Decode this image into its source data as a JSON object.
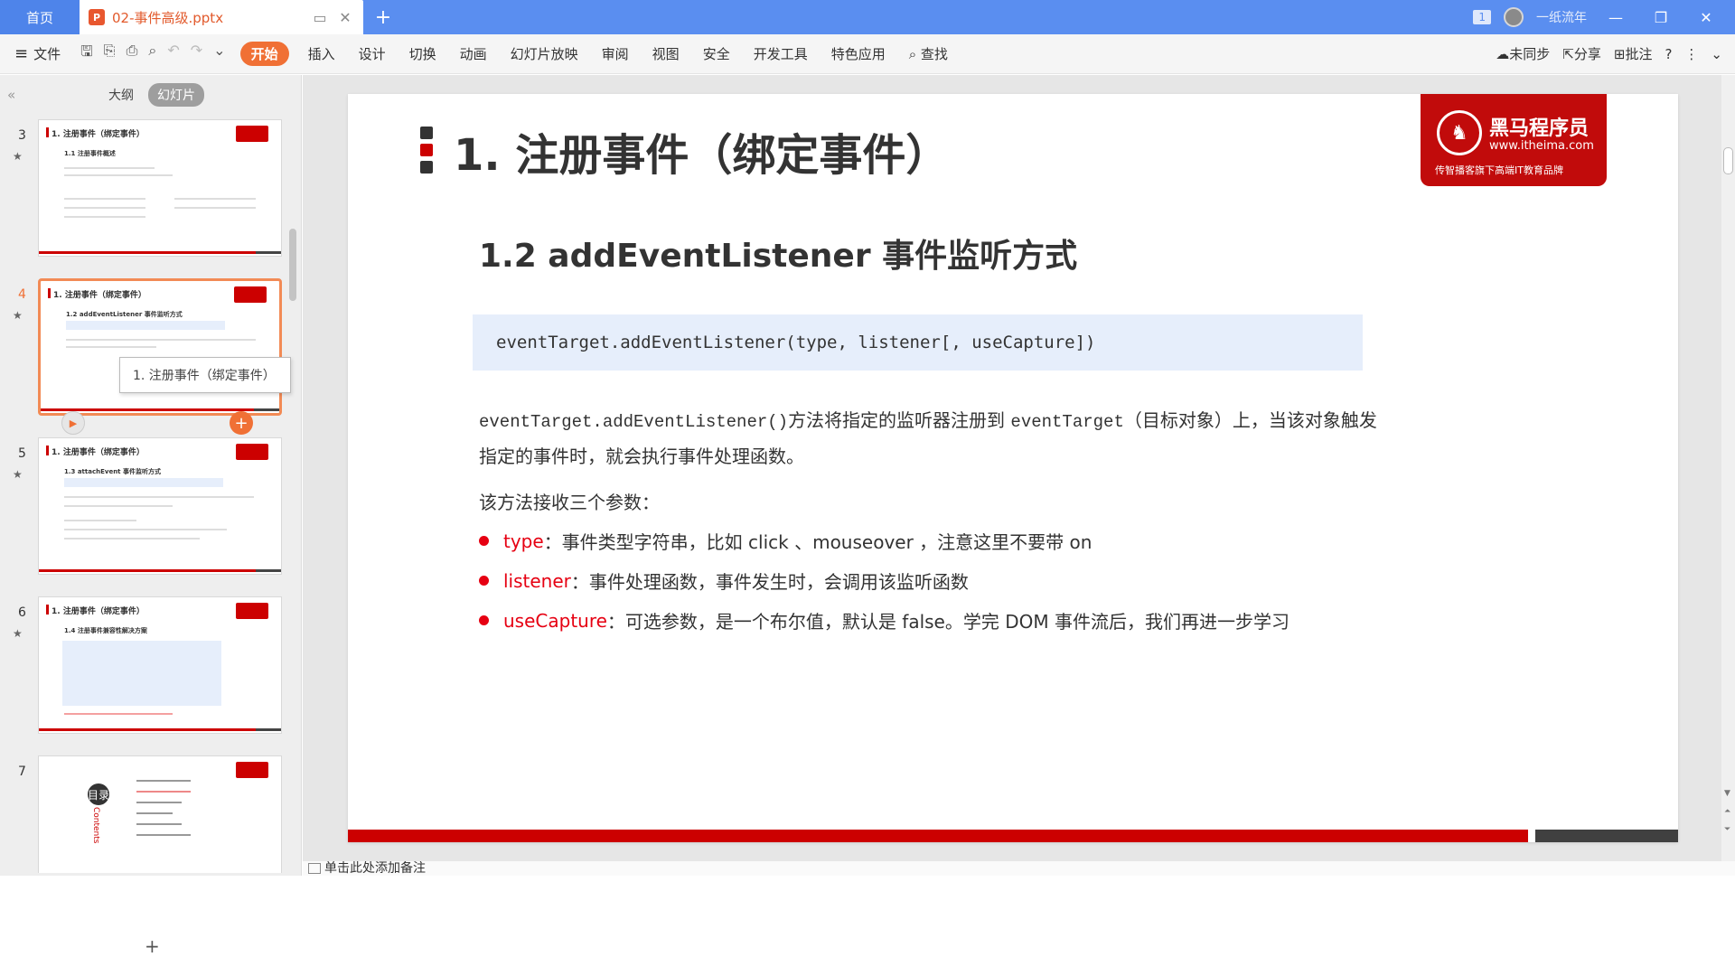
{
  "titlebar": {
    "home_tab": "首页",
    "doc_tab": "02-事件高级.pptx",
    "page_badge": "1",
    "user": "一纸流年"
  },
  "ribbon": {
    "file": "文件",
    "tabs": [
      "开始",
      "插入",
      "设计",
      "切换",
      "动画",
      "幻灯片放映",
      "审阅",
      "视图",
      "安全",
      "开发工具",
      "特色应用"
    ],
    "search": "查找",
    "sync": "未同步",
    "share": "分享",
    "comment": "批注"
  },
  "left_panel": {
    "outline": "大纲",
    "slides": "幻灯片",
    "tooltip": "1. 注册事件（绑定事件）",
    "thumbnails": [
      {
        "num": "3",
        "title": "1. 注册事件（绑定事件）",
        "sub": "1.1 注册事件概述"
      },
      {
        "num": "4",
        "title": "1. 注册事件（绑定事件）",
        "sub": "1.2 addEventListener 事件监听方式"
      },
      {
        "num": "5",
        "title": "1. 注册事件（绑定事件）",
        "sub": "1.3 attachEvent 事件监听方式"
      },
      {
        "num": "6",
        "title": "1. 注册事件（绑定事件）",
        "sub": "1.4 注册事件兼容性解决方案"
      },
      {
        "num": "7",
        "title": "目录",
        "sub": "Contents"
      }
    ]
  },
  "slide": {
    "title": "1. 注册事件（绑定事件）",
    "logo_name": "黑马程序员",
    "logo_url": "www.itheima.com",
    "logo_slogan": "传智播客旗下高端IT教育品牌",
    "subtitle": "1.2 addEventListener 事件监听方式",
    "code": "eventTarget.addEventListener(type, listener[, useCapture])",
    "para_code": "eventTarget.addEventListener()",
    "para_text1": "方法将指定的监听器注册到 ",
    "para_code2": "eventTarget",
    "para_text2": "（目标对象）上，当该对象触发指定的事件时，就会执行事件处理函数。",
    "intro": "该方法接收三个参数：",
    "bullets": [
      {
        "key": "type",
        "text": "：事件类型字符串，比如 click 、mouseover ，注意这里不要带 on"
      },
      {
        "key": "listener",
        "text": "：事件处理函数，事件发生时，会调用该监听函数"
      },
      {
        "key": "useCapture",
        "text": "：可选参数，是一个布尔值，默认是 false。学完 DOM 事件流后，我们再进一步学习"
      }
    ]
  },
  "notes": "单击此处添加备注"
}
